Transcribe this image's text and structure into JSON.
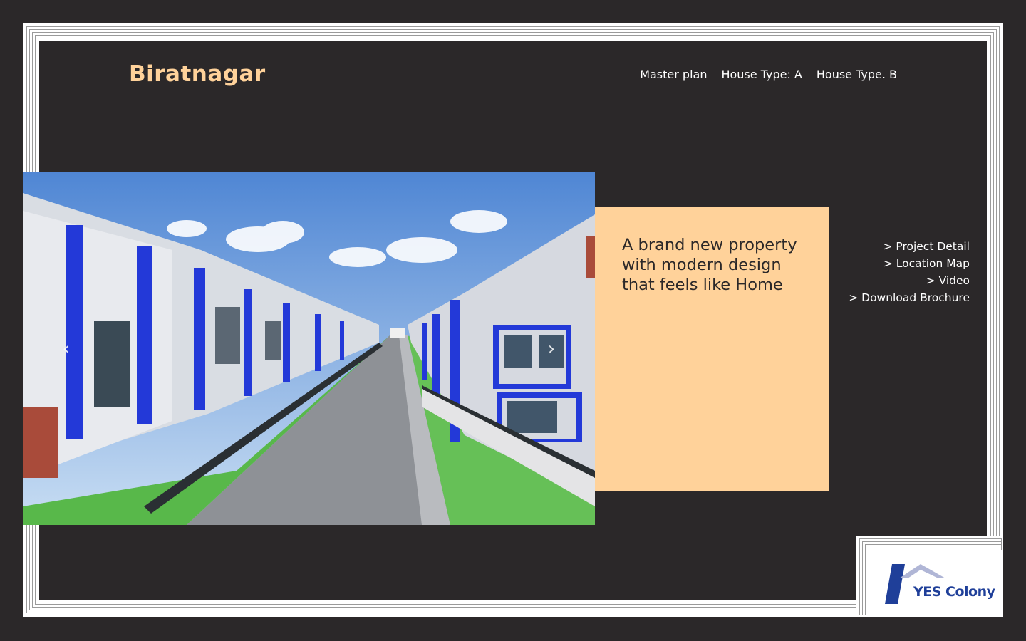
{
  "header": {
    "brand_title": "Biratnagar",
    "nav": [
      {
        "label": "Master plan"
      },
      {
        "label": "House Type: A"
      },
      {
        "label": "House Type. B"
      }
    ]
  },
  "carousel": {
    "prev_icon": "chevron-left-icon",
    "next_icon": "chevron-right-icon",
    "prev_glyph": "‹",
    "next_glyph": "›"
  },
  "info_panel": {
    "headline": "A brand new property with modern design that feels like Home"
  },
  "side_links": [
    {
      "label": "> Project Detail"
    },
    {
      "label": "> Location Map"
    },
    {
      "label": "> Video"
    },
    {
      "label": "> Download Brochure"
    }
  ],
  "logo": {
    "text": "YES Colony"
  },
  "colors": {
    "background": "#2b2829",
    "accent": "#ffd29a",
    "logo_blue": "#1f3f99"
  }
}
